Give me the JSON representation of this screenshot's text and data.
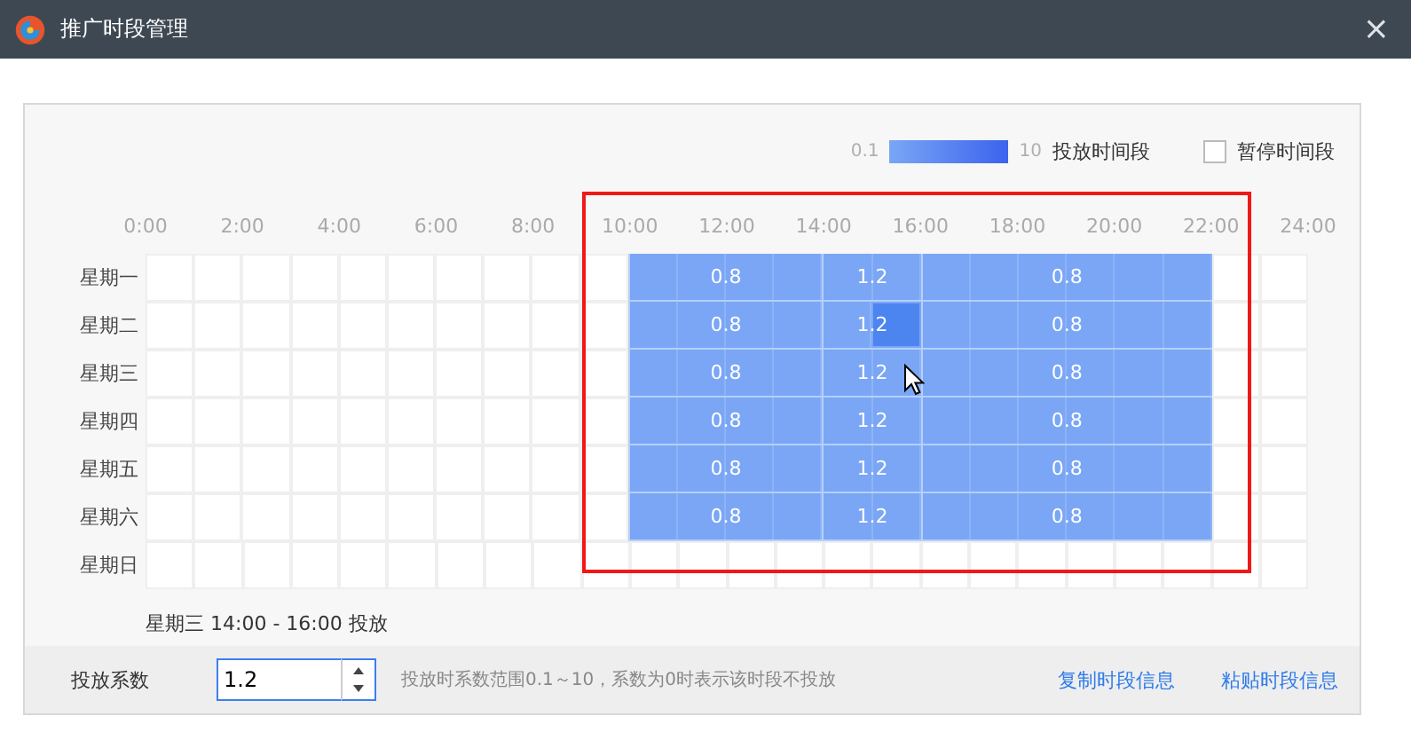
{
  "window": {
    "title": "推广时段管理",
    "close": "×"
  },
  "legend": {
    "min": "0.1",
    "max": "10",
    "label": "投放时间段",
    "pause_label": "暂停时间段",
    "pause_checked": false
  },
  "hours": [
    "0:00",
    "2:00",
    "4:00",
    "6:00",
    "8:00",
    "10:00",
    "12:00",
    "14:00",
    "16:00",
    "18:00",
    "20:00",
    "22:00",
    "24:00"
  ],
  "days": [
    {
      "label": "星期一",
      "blocks": [
        {
          "kind": "empty",
          "slots": [
            {
              "hover": false
            },
            {
              "hover": false
            },
            {
              "hover": false
            },
            {
              "hover": false
            },
            {
              "hover": false
            },
            {
              "hover": false
            },
            {
              "hover": false
            },
            {
              "hover": false
            },
            {
              "hover": false
            },
            {
              "hover": false
            }
          ]
        },
        {
          "kind": "active",
          "value": "0.8",
          "slots": [
            {
              "hover": false
            },
            {
              "hover": false
            },
            {
              "hover": false
            },
            {
              "hover": false
            }
          ]
        },
        {
          "kind": "active",
          "value": "1.2",
          "slots": [
            {
              "hover": false
            },
            {
              "hover": false
            }
          ]
        },
        {
          "kind": "active",
          "value": "0.8",
          "slots": [
            {
              "hover": false
            },
            {
              "hover": false
            },
            {
              "hover": false
            },
            {
              "hover": false
            },
            {
              "hover": false
            },
            {
              "hover": false
            }
          ]
        },
        {
          "kind": "empty",
          "slots": [
            {
              "hover": false
            },
            {
              "hover": false
            }
          ]
        }
      ]
    },
    {
      "label": "星期二",
      "blocks": [
        {
          "kind": "empty",
          "slots": [
            {
              "hover": false
            },
            {
              "hover": false
            },
            {
              "hover": false
            },
            {
              "hover": false
            },
            {
              "hover": false
            },
            {
              "hover": false
            },
            {
              "hover": false
            },
            {
              "hover": false
            },
            {
              "hover": false
            },
            {
              "hover": false
            }
          ]
        },
        {
          "kind": "active",
          "value": "0.8",
          "slots": [
            {
              "hover": false
            },
            {
              "hover": false
            },
            {
              "hover": false
            },
            {
              "hover": false
            }
          ]
        },
        {
          "kind": "active",
          "value": "1.2",
          "slots": [
            {
              "hover": false
            },
            {
              "hover": true
            }
          ]
        },
        {
          "kind": "active",
          "value": "0.8",
          "slots": [
            {
              "hover": false
            },
            {
              "hover": false
            },
            {
              "hover": false
            },
            {
              "hover": false
            },
            {
              "hover": false
            },
            {
              "hover": false
            }
          ]
        },
        {
          "kind": "empty",
          "slots": [
            {
              "hover": false
            },
            {
              "hover": false
            }
          ]
        }
      ]
    },
    {
      "label": "星期三",
      "blocks": [
        {
          "kind": "empty",
          "slots": [
            {
              "hover": false
            },
            {
              "hover": false
            },
            {
              "hover": false
            },
            {
              "hover": false
            },
            {
              "hover": false
            },
            {
              "hover": false
            },
            {
              "hover": false
            },
            {
              "hover": false
            },
            {
              "hover": false
            },
            {
              "hover": false
            }
          ]
        },
        {
          "kind": "active",
          "value": "0.8",
          "slots": [
            {
              "hover": false
            },
            {
              "hover": false
            },
            {
              "hover": false
            },
            {
              "hover": false
            }
          ]
        },
        {
          "kind": "active",
          "value": "1.2",
          "slots": [
            {
              "hover": false
            },
            {
              "hover": false
            }
          ]
        },
        {
          "kind": "active",
          "value": "0.8",
          "slots": [
            {
              "hover": false
            },
            {
              "hover": false
            },
            {
              "hover": false
            },
            {
              "hover": false
            },
            {
              "hover": false
            },
            {
              "hover": false
            }
          ]
        },
        {
          "kind": "empty",
          "slots": [
            {
              "hover": false
            },
            {
              "hover": false
            }
          ]
        }
      ]
    },
    {
      "label": "星期四",
      "blocks": [
        {
          "kind": "empty",
          "slots": [
            {
              "hover": false
            },
            {
              "hover": false
            },
            {
              "hover": false
            },
            {
              "hover": false
            },
            {
              "hover": false
            },
            {
              "hover": false
            },
            {
              "hover": false
            },
            {
              "hover": false
            },
            {
              "hover": false
            },
            {
              "hover": false
            }
          ]
        },
        {
          "kind": "active",
          "value": "0.8",
          "slots": [
            {
              "hover": false
            },
            {
              "hover": false
            },
            {
              "hover": false
            },
            {
              "hover": false
            }
          ]
        },
        {
          "kind": "active",
          "value": "1.2",
          "slots": [
            {
              "hover": false
            },
            {
              "hover": false
            }
          ]
        },
        {
          "kind": "active",
          "value": "0.8",
          "slots": [
            {
              "hover": false
            },
            {
              "hover": false
            },
            {
              "hover": false
            },
            {
              "hover": false
            },
            {
              "hover": false
            },
            {
              "hover": false
            }
          ]
        },
        {
          "kind": "empty",
          "slots": [
            {
              "hover": false
            },
            {
              "hover": false
            }
          ]
        }
      ]
    },
    {
      "label": "星期五",
      "blocks": [
        {
          "kind": "empty",
          "slots": [
            {
              "hover": false
            },
            {
              "hover": false
            },
            {
              "hover": false
            },
            {
              "hover": false
            },
            {
              "hover": false
            },
            {
              "hover": false
            },
            {
              "hover": false
            },
            {
              "hover": false
            },
            {
              "hover": false
            },
            {
              "hover": false
            }
          ]
        },
        {
          "kind": "active",
          "value": "0.8",
          "slots": [
            {
              "hover": false
            },
            {
              "hover": false
            },
            {
              "hover": false
            },
            {
              "hover": false
            }
          ]
        },
        {
          "kind": "active",
          "value": "1.2",
          "slots": [
            {
              "hover": false
            },
            {
              "hover": false
            }
          ]
        },
        {
          "kind": "active",
          "value": "0.8",
          "slots": [
            {
              "hover": false
            },
            {
              "hover": false
            },
            {
              "hover": false
            },
            {
              "hover": false
            },
            {
              "hover": false
            },
            {
              "hover": false
            }
          ]
        },
        {
          "kind": "empty",
          "slots": [
            {
              "hover": false
            },
            {
              "hover": false
            }
          ]
        }
      ]
    },
    {
      "label": "星期六",
      "blocks": [
        {
          "kind": "empty",
          "slots": [
            {
              "hover": false
            },
            {
              "hover": false
            },
            {
              "hover": false
            },
            {
              "hover": false
            },
            {
              "hover": false
            },
            {
              "hover": false
            },
            {
              "hover": false
            },
            {
              "hover": false
            },
            {
              "hover": false
            },
            {
              "hover": false
            }
          ]
        },
        {
          "kind": "active",
          "value": "0.8",
          "slots": [
            {
              "hover": false
            },
            {
              "hover": false
            },
            {
              "hover": false
            },
            {
              "hover": false
            }
          ]
        },
        {
          "kind": "active",
          "value": "1.2",
          "slots": [
            {
              "hover": false
            },
            {
              "hover": false
            }
          ]
        },
        {
          "kind": "active",
          "value": "0.8",
          "slots": [
            {
              "hover": false
            },
            {
              "hover": false
            },
            {
              "hover": false
            },
            {
              "hover": false
            },
            {
              "hover": false
            },
            {
              "hover": false
            }
          ]
        },
        {
          "kind": "empty",
          "slots": [
            {
              "hover": false
            },
            {
              "hover": false
            }
          ]
        }
      ]
    },
    {
      "label": "星期日",
      "blocks": [
        {
          "kind": "empty",
          "slots": [
            {
              "hover": false
            },
            {
              "hover": false
            },
            {
              "hover": false
            },
            {
              "hover": false
            },
            {
              "hover": false
            },
            {
              "hover": false
            },
            {
              "hover": false
            },
            {
              "hover": false
            },
            {
              "hover": false
            },
            {
              "hover": false
            },
            {
              "hover": false
            },
            {
              "hover": false
            },
            {
              "hover": false
            },
            {
              "hover": false
            },
            {
              "hover": false
            },
            {
              "hover": false
            },
            {
              "hover": false
            },
            {
              "hover": false
            },
            {
              "hover": false
            },
            {
              "hover": false
            },
            {
              "hover": false
            },
            {
              "hover": false
            },
            {
              "hover": false
            },
            {
              "hover": false
            }
          ]
        }
      ]
    }
  ],
  "status": "星期三 14:00 - 16:00 投放",
  "coefficient": {
    "label": "投放系数",
    "value": "1.2",
    "hint": "投放时系数范围0.1～10，系数为0时表示该时段不投放"
  },
  "links": [
    "复制时段信息",
    "粘贴时段信息"
  ]
}
